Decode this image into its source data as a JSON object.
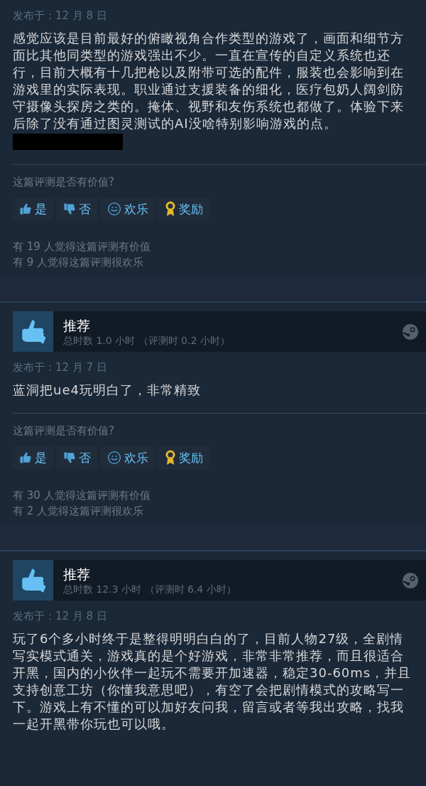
{
  "reviews": [
    {
      "posted": "发布于：12 月 8 日",
      "text": "感觉应该是目前最好的俯瞰视角合作类型的游戏了，画面和细节方面比其他同类型的游戏强出不少。一直在宣传的自定义系统也还行，目前大概有十几把枪以及附带可选的配件，服装也会影响到在游戏里的实际表现。职业通过支援装备的细化，医疗包奶人阔剑防守摄像头探房之类的。掩体、视野和友伤系统也都做了。体验下来后除了没有通过图灵测试的AI没啥特别影响游戏的点。",
      "redacted": true,
      "question": "这篇评测是否有价值?",
      "buttons": [
        {
          "kind": "yes",
          "label": "是"
        },
        {
          "kind": "no",
          "label": "否"
        },
        {
          "kind": "funny",
          "label": "欢乐"
        },
        {
          "kind": "award",
          "label": "奖励"
        }
      ],
      "counts": [
        "有 19 人觉得这篇评测有价值",
        "有 9 人觉得这篇评测很欢乐"
      ]
    },
    {
      "recommendation": {
        "title": "推荐",
        "playtime": "总时数 1.0 小时 （评测时 0.2 小时）"
      },
      "posted": "发布于：12 月 7 日",
      "text": "蓝洞把ue4玩明白了，非常精致",
      "redacted": false,
      "question": "这篇评测是否有价值?",
      "buttons": [
        {
          "kind": "yes",
          "label": "是"
        },
        {
          "kind": "no",
          "label": "否"
        },
        {
          "kind": "funny",
          "label": "欢乐"
        },
        {
          "kind": "award",
          "label": "奖励"
        }
      ],
      "counts": [
        "有 30 人觉得这篇评测有价值",
        "有 2 人觉得这篇评测很欢乐"
      ]
    },
    {
      "recommendation": {
        "title": "推荐",
        "playtime": "总时数 12.3 小时 （评测时 6.4 小时）"
      },
      "posted": "发布于：12 月 8 日",
      "text": "玩了6个多小时终于是整得明明白白的了，目前人物27级，全剧情写实模式通关，游戏真的是个好游戏，非常非常推荐，而且很适合开黑，国内的小伙伴一起玩不需要开加速器，稳定30-60ms，并且支持创意工坊（你懂我意思吧），有空了会把剧情模式的攻略写一下。游戏上有不懂的可以加好友问我，留言或者等我出攻略，找我一起开黑带你玩也可以哦。",
      "redacted": false
    }
  ]
}
